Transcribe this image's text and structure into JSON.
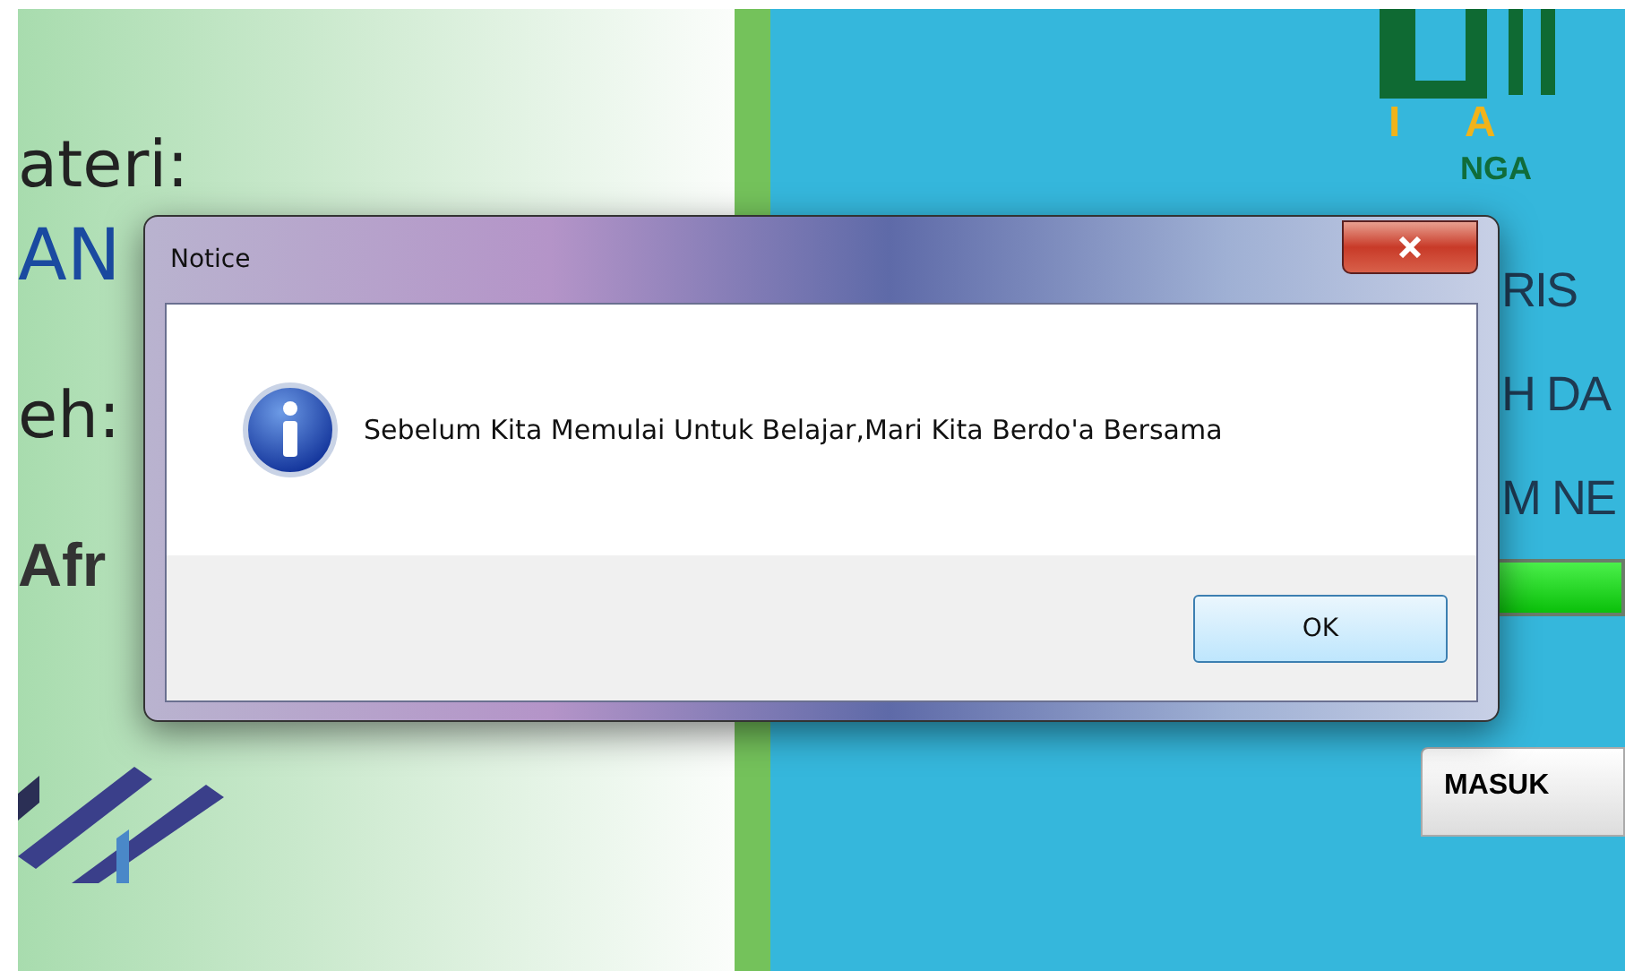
{
  "background": {
    "left_texts": [
      {
        "kind": "label",
        "text": "ateri:"
      },
      {
        "kind": "title",
        "text": "AN"
      },
      {
        "kind": "label",
        "text": "eh:"
      },
      {
        "kind": "name",
        "text": "Afr"
      }
    ],
    "logo": {
      "letters": "I A",
      "tagline": "NGA"
    },
    "right_texts": [
      "RIS",
      "H DA",
      "M NE"
    ],
    "progress": {
      "level": 1
    },
    "enter_button": "MASUK"
  },
  "dialog": {
    "title": "Notice",
    "message": "Sebelum Kita Memulai Untuk Belajar,Mari Kita Berdo'a Bersama",
    "buttons": [
      "OK"
    ]
  }
}
